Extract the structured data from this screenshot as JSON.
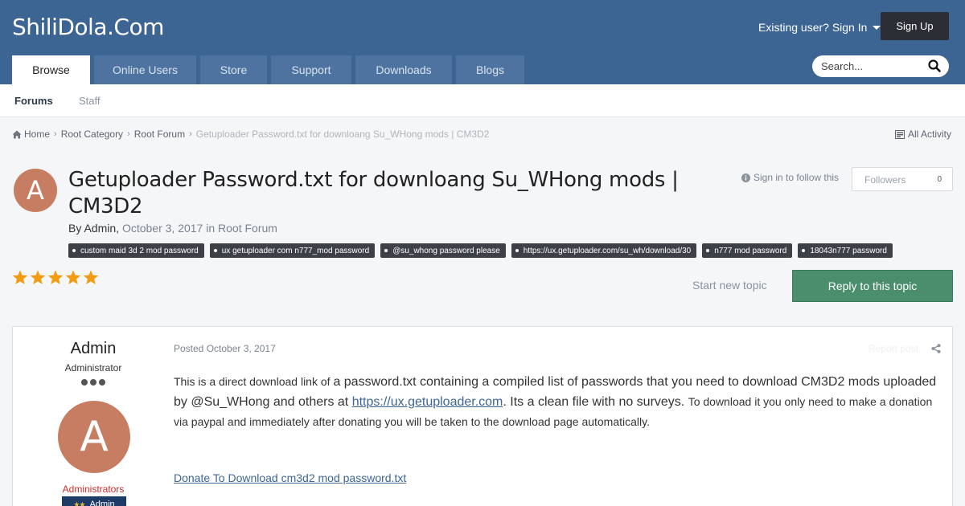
{
  "header": {
    "site_title": "ShiliDola.Com",
    "sign_in": "Existing user? Sign In",
    "sign_up": "Sign Up",
    "tabs": [
      {
        "label": "Browse"
      },
      {
        "label": "Online Users"
      },
      {
        "label": "Store"
      },
      {
        "label": "Support"
      },
      {
        "label": "Downloads"
      },
      {
        "label": "Blogs"
      }
    ],
    "search_placeholder": "Search..."
  },
  "subnav": {
    "items": [
      {
        "label": "Forums"
      },
      {
        "label": "Staff"
      }
    ]
  },
  "breadcrumb": {
    "items": [
      {
        "label": "Home"
      },
      {
        "label": "Root Category"
      },
      {
        "label": "Root Forum"
      },
      {
        "label": "Getuploader Password.txt for downloang Su_WHong mods | CM3D2"
      }
    ],
    "all_activity": "All Activity"
  },
  "topic": {
    "avatar_letter": "A",
    "title": "Getuploader Password.txt for downloang Su_WHong mods | CM3D2",
    "by": "By",
    "author": "Admin",
    "comma": ",",
    "date": "October 3, 2017",
    "in": "in",
    "forum": "Root Forum",
    "follow_text": "Sign in to follow this",
    "followers_label": "Followers",
    "followers_count": "0",
    "tags": [
      "custom maid 3d 2 mod password",
      "ux getuploader com n777_mod password",
      "@su_whong password please",
      "https://ux.getuploader.com/su_wh/download/30",
      "n777 mod password",
      "18043n777 password"
    ],
    "rating": 5,
    "start_new_topic": "Start new topic",
    "reply": "Reply to this topic"
  },
  "post": {
    "author_name": "Admin",
    "author_role": "Administrator",
    "avatar_letter": "A",
    "group": "Administrators",
    "badge": "Admin",
    "badge_stars": "★★",
    "posted": "Posted October 3, 2017",
    "report": "Report post",
    "body_part1": "This is a direct download link of ",
    "body_part2": "a password.txt containing a compiled list of passwords that you need to download CM3D2 mods uploaded by @Su_WHong and others at ",
    "body_link": "https://ux.getuploader.com",
    "body_part3": ". Its a clean file with no surveys. ",
    "body_part4": "To download it you only need to make a donation via paypal and immediately after donating you will be taken to the download page automatically.",
    "donate_link": "Donate To Download cm3d2 mod password.txt"
  },
  "colors": {
    "header_bg": "#3d6594",
    "tab_bg": "#4f73a0",
    "signup_bg": "#2b2f35",
    "reply_bg": "#4a8e6e",
    "star": "#f39c12",
    "avatar": "#c77d61",
    "group_red": "#cc2a2a"
  }
}
